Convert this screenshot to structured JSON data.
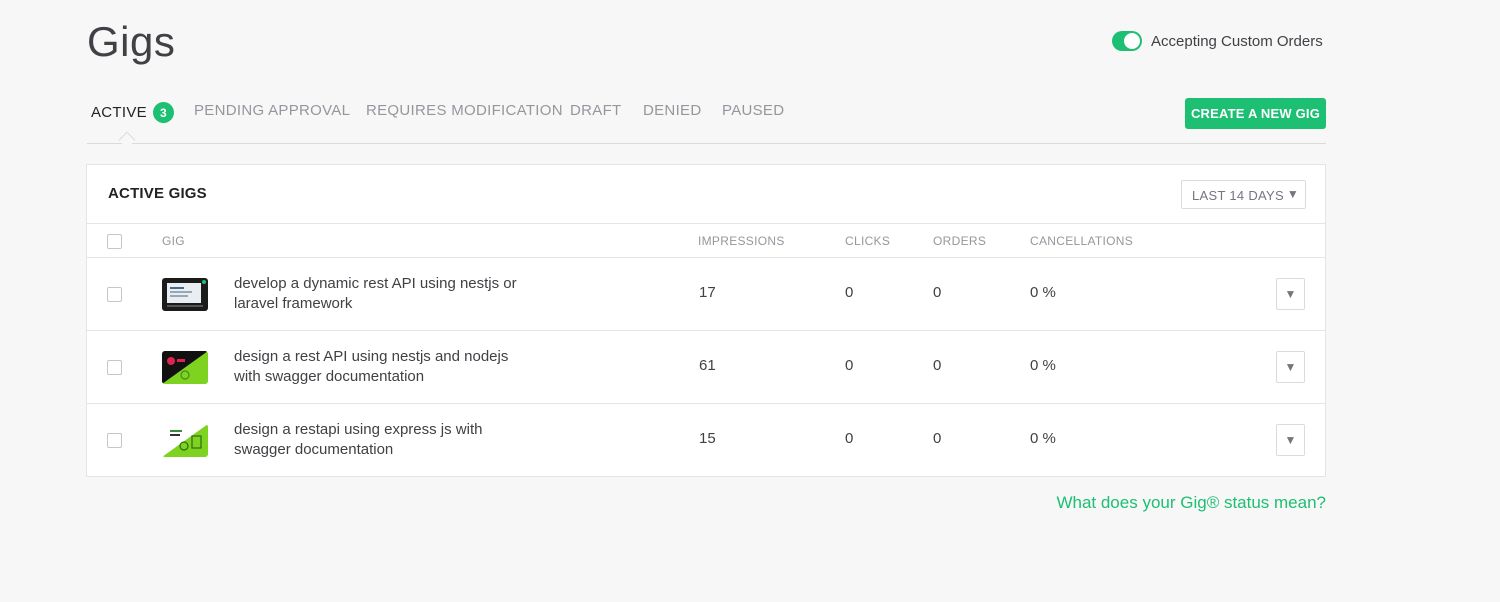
{
  "header": {
    "title": "Gigs",
    "custom_orders_label": "Accepting Custom Orders",
    "custom_orders_on": true
  },
  "tabs": [
    {
      "label": "ACTIVE",
      "count": "3",
      "active": true
    },
    {
      "label": "PENDING APPROVAL"
    },
    {
      "label": "REQUIRES MODIFICATION"
    },
    {
      "label": "DRAFT"
    },
    {
      "label": "DENIED"
    },
    {
      "label": "PAUSED"
    }
  ],
  "create_button": "CREATE A NEW GIG",
  "panel": {
    "title": "ACTIVE GIGS",
    "range": "LAST 14 DAYS",
    "range_arrow": "▼"
  },
  "columns": {
    "gig": "GIG",
    "impressions": "IMPRESSIONS",
    "clicks": "CLICKS",
    "orders": "ORDERS",
    "cancellations": "CANCELLATIONS"
  },
  "rows": [
    {
      "title": "develop a dynamic rest API using nestjs or laravel framework",
      "impressions": "17",
      "clicks": "0",
      "orders": "0",
      "cancellations": "0 %",
      "menu": "▼"
    },
    {
      "title": "design a rest API using nestjs and nodejs with swagger documentation",
      "impressions": "61",
      "clicks": "0",
      "orders": "0",
      "cancellations": "0 %",
      "menu": "▼"
    },
    {
      "title": "design a restapi using express js with swagger documentation",
      "impressions": "15",
      "clicks": "0",
      "orders": "0",
      "cancellations": "0 %",
      "menu": "▼"
    }
  ],
  "footer_link": "What does your Gig® status mean?",
  "colors": {
    "accent": "#1dbf73",
    "text": "#404145",
    "muted": "#95979d"
  }
}
